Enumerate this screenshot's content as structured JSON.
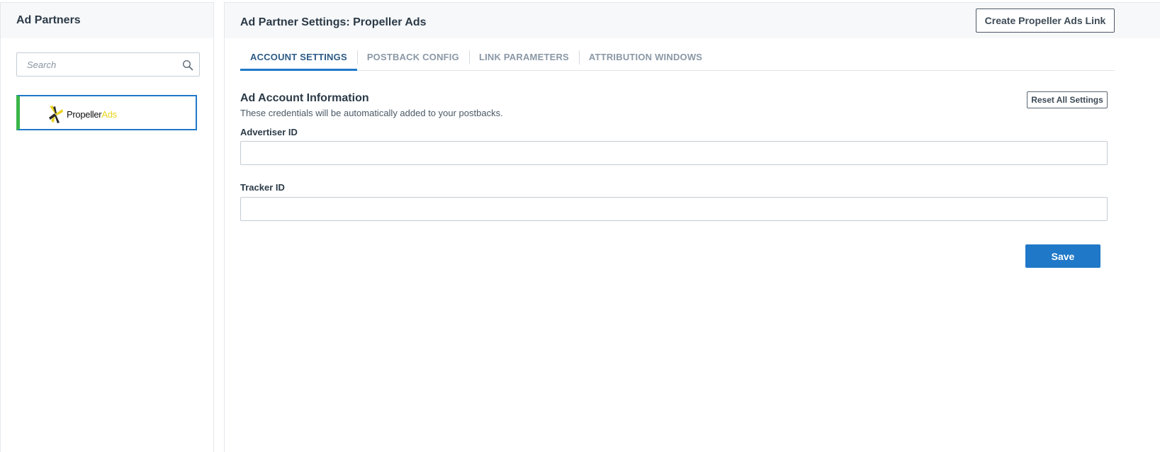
{
  "sidebar": {
    "title": "Ad Partners",
    "search": {
      "placeholder": "Search",
      "value": ""
    },
    "partners": [
      {
        "name": "Propeller Ads",
        "logo_text_primary": "Propeller",
        "logo_text_accent": "Ads",
        "selected": true
      }
    ]
  },
  "main": {
    "title": "Ad Partner Settings: Propeller Ads",
    "create_link_label": "Create Propeller Ads Link",
    "tabs": [
      {
        "label": "ACCOUNT SETTINGS",
        "active": true
      },
      {
        "label": "POSTBACK CONFIG",
        "active": false
      },
      {
        "label": "LINK PARAMETERS",
        "active": false
      },
      {
        "label": "ATTRIBUTION WINDOWS",
        "active": false
      }
    ],
    "section": {
      "title": "Ad Account Information",
      "description": "These credentials will be automatically added to your postbacks.",
      "reset_label": "Reset All Settings"
    },
    "fields": [
      {
        "label": "Advertiser ID",
        "value": ""
      },
      {
        "label": "Tracker ID",
        "value": ""
      }
    ],
    "save_label": "Save"
  },
  "colors": {
    "accent_blue": "#1f78c8",
    "selected_green": "#3cb54a",
    "logo_yellow": "#e8d420",
    "header_bg": "#f7f8fa"
  }
}
